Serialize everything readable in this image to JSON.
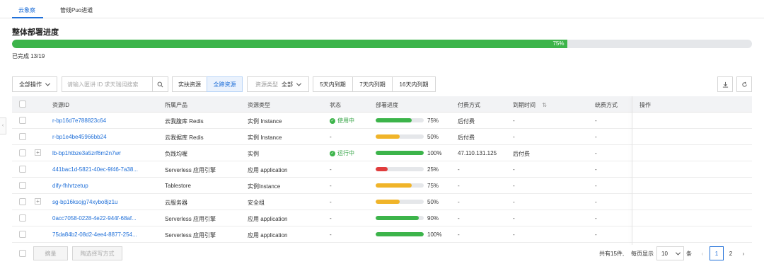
{
  "tabs": [
    {
      "label": "云象察",
      "active": true
    },
    {
      "label": "管线Puo进道",
      "active": false
    }
  ],
  "title": "整体部署进度",
  "overall": {
    "percent": 75,
    "percent_label": "75%",
    "completed_label": "已完成 13/19"
  },
  "toolbar": {
    "bulk_action": "全部操作",
    "search_placeholder": "请输入匿讲 ID 求天瑞阔搜索",
    "filter_tabs": [
      "实扶资源",
      "全蹄资源"
    ],
    "resource_type_label": "资源类型",
    "resource_type_value": "全部",
    "expiry_tabs": [
      "5天内到期",
      "7天内列期",
      "16天内列期"
    ]
  },
  "columns": [
    "资源ID",
    "所属产品",
    "资源类型",
    "状态",
    "部署进度",
    "付费方式",
    "到期时间",
    "统费方式",
    "操作"
  ],
  "sort_icon": "⇅",
  "rows": [
    {
      "id": "r-bp16d7e788823c64",
      "product": "云我腹库 Redis",
      "type": "实例 Instance",
      "status": "使用中",
      "status_icon": true,
      "progress": 75,
      "progress_label": "75%",
      "bar_color": "#3cb44a",
      "pay": "后付费",
      "expire": "-",
      "renew": "-",
      "expandable": false
    },
    {
      "id": "r-bp1e4be45966bb24",
      "product": "云我据库 Redis",
      "type": "实例 Instance",
      "status": "-",
      "status_icon": false,
      "progress": 50,
      "progress_label": "50%",
      "bar_color": "#f0b429",
      "pay": "后付费",
      "expire": "-",
      "renew": "-",
      "expandable": false
    },
    {
      "id": "lb-bp1htbze3a5zrf6m2n7wr",
      "product": "负践均喔",
      "type": "实例",
      "status": "运行中",
      "status_icon": true,
      "progress": 100,
      "progress_label": "100%",
      "bar_color": "#3cb44a",
      "pay": "47.110.131.125",
      "expire": "后付费",
      "renew": "-",
      "expandable": true
    },
    {
      "id": "441bac1d-5821-40ec-9f46-7a38...",
      "product": "Serverless 应用引擎",
      "type": "应用 application",
      "status": "-",
      "status_icon": false,
      "progress": 25,
      "progress_label": "25%",
      "bar_color": "#e03c3c",
      "pay": "-",
      "expire": "-",
      "renew": "-",
      "expandable": false
    },
    {
      "id": "dify-fhhrtzetup",
      "product": "Tablestore",
      "type": "实例Instance",
      "status": "-",
      "status_icon": false,
      "progress": 75,
      "progress_label": "75%",
      "bar_color": "#f0b429",
      "pay": "-",
      "expire": "-",
      "renew": "-",
      "expandable": false
    },
    {
      "id": "sg-bp16ksojg74xybo8jz1u",
      "product": "云服务器",
      "type": "安全组",
      "status": "-",
      "status_icon": false,
      "progress": 50,
      "progress_label": "50%",
      "bar_color": "#f0b429",
      "pay": "-",
      "expire": "-",
      "renew": "-",
      "expandable": true
    },
    {
      "id": "0acc7058-0228-4e22-944f-68af...",
      "product": "Serverless 应用引擎",
      "type": "应用 application",
      "status": "-",
      "status_icon": false,
      "progress": 90,
      "progress_label": "90%",
      "bar_color": "#3cb44a",
      "pay": "-",
      "expire": "-",
      "renew": "-",
      "expandable": false
    },
    {
      "id": "75da84b2-08d2-4ee4-8877-254...",
      "product": "Serverless 应用引擎",
      "type": "应用 application",
      "status": "-",
      "status_icon": false,
      "progress": 100,
      "progress_label": "100%",
      "bar_color": "#3cb44a",
      "pay": "-",
      "expire": "-",
      "renew": "-",
      "expandable": false
    }
  ],
  "footer": {
    "btn_batch": "摘量",
    "btn_pay": "陶选择写方式",
    "total": "共有15件,",
    "per_page_label": "每页显示",
    "per_page_value": "10",
    "per_page_unit": "条",
    "pages": [
      "1",
      "2"
    ],
    "current_page": "1"
  }
}
